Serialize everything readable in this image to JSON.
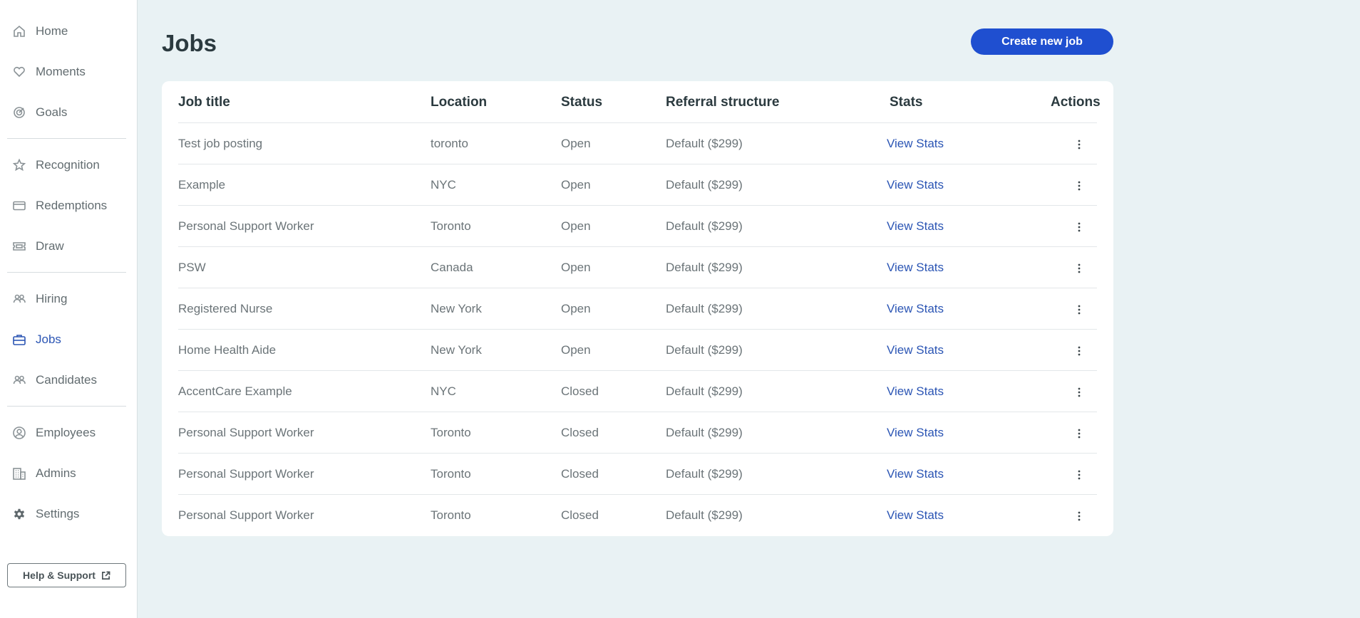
{
  "sidebar": {
    "items": [
      {
        "label": "Home",
        "icon": "home-icon"
      },
      {
        "label": "Moments",
        "icon": "heart-icon"
      },
      {
        "label": "Goals",
        "icon": "target-icon"
      },
      {
        "label": "Recognition",
        "icon": "star-icon"
      },
      {
        "label": "Redemptions",
        "icon": "card-icon"
      },
      {
        "label": "Draw",
        "icon": "ticket-icon"
      },
      {
        "label": "Hiring",
        "icon": "people-icon"
      },
      {
        "label": "Jobs",
        "icon": "briefcase-icon",
        "active": true
      },
      {
        "label": "Candidates",
        "icon": "people-icon"
      },
      {
        "label": "Employees",
        "icon": "user-circle-icon"
      },
      {
        "label": "Admins",
        "icon": "building-icon"
      },
      {
        "label": "Settings",
        "icon": "gear-icon"
      }
    ],
    "help_label": "Help & Support"
  },
  "page": {
    "title": "Jobs",
    "create_button": "Create new job"
  },
  "table": {
    "headers": [
      "Job title",
      "Location",
      "Status",
      "Referral structure",
      "Stats",
      "Actions"
    ],
    "rows": [
      {
        "title": "Test job posting",
        "location": "toronto",
        "status": "Open",
        "referral": "Default ($299)",
        "stats": "View Stats"
      },
      {
        "title": "Example",
        "location": "NYC",
        "status": "Open",
        "referral": "Default ($299)",
        "stats": "View Stats"
      },
      {
        "title": "Personal Support Worker",
        "location": "Toronto",
        "status": "Open",
        "referral": "Default ($299)",
        "stats": "View Stats"
      },
      {
        "title": "PSW",
        "location": "Canada",
        "status": "Open",
        "referral": "Default ($299)",
        "stats": "View Stats"
      },
      {
        "title": "Registered Nurse",
        "location": "New York",
        "status": "Open",
        "referral": "Default ($299)",
        "stats": "View Stats"
      },
      {
        "title": "Home Health Aide",
        "location": "New York",
        "status": "Open",
        "referral": "Default ($299)",
        "stats": "View Stats"
      },
      {
        "title": "AccentCare Example",
        "location": "NYC",
        "status": "Closed",
        "referral": "Default ($299)",
        "stats": "View Stats"
      },
      {
        "title": "Personal Support Worker",
        "location": "Toronto",
        "status": "Closed",
        "referral": "Default ($299)",
        "stats": "View Stats"
      },
      {
        "title": "Personal Support Worker",
        "location": "Toronto",
        "status": "Closed",
        "referral": "Default ($299)",
        "stats": "View Stats"
      },
      {
        "title": "Personal Support Worker",
        "location": "Toronto",
        "status": "Closed",
        "referral": "Default ($299)",
        "stats": "View Stats"
      }
    ]
  },
  "colors": {
    "accent": "#1f4fd0",
    "link": "#2b55b4",
    "background": "#e9f2f4"
  }
}
